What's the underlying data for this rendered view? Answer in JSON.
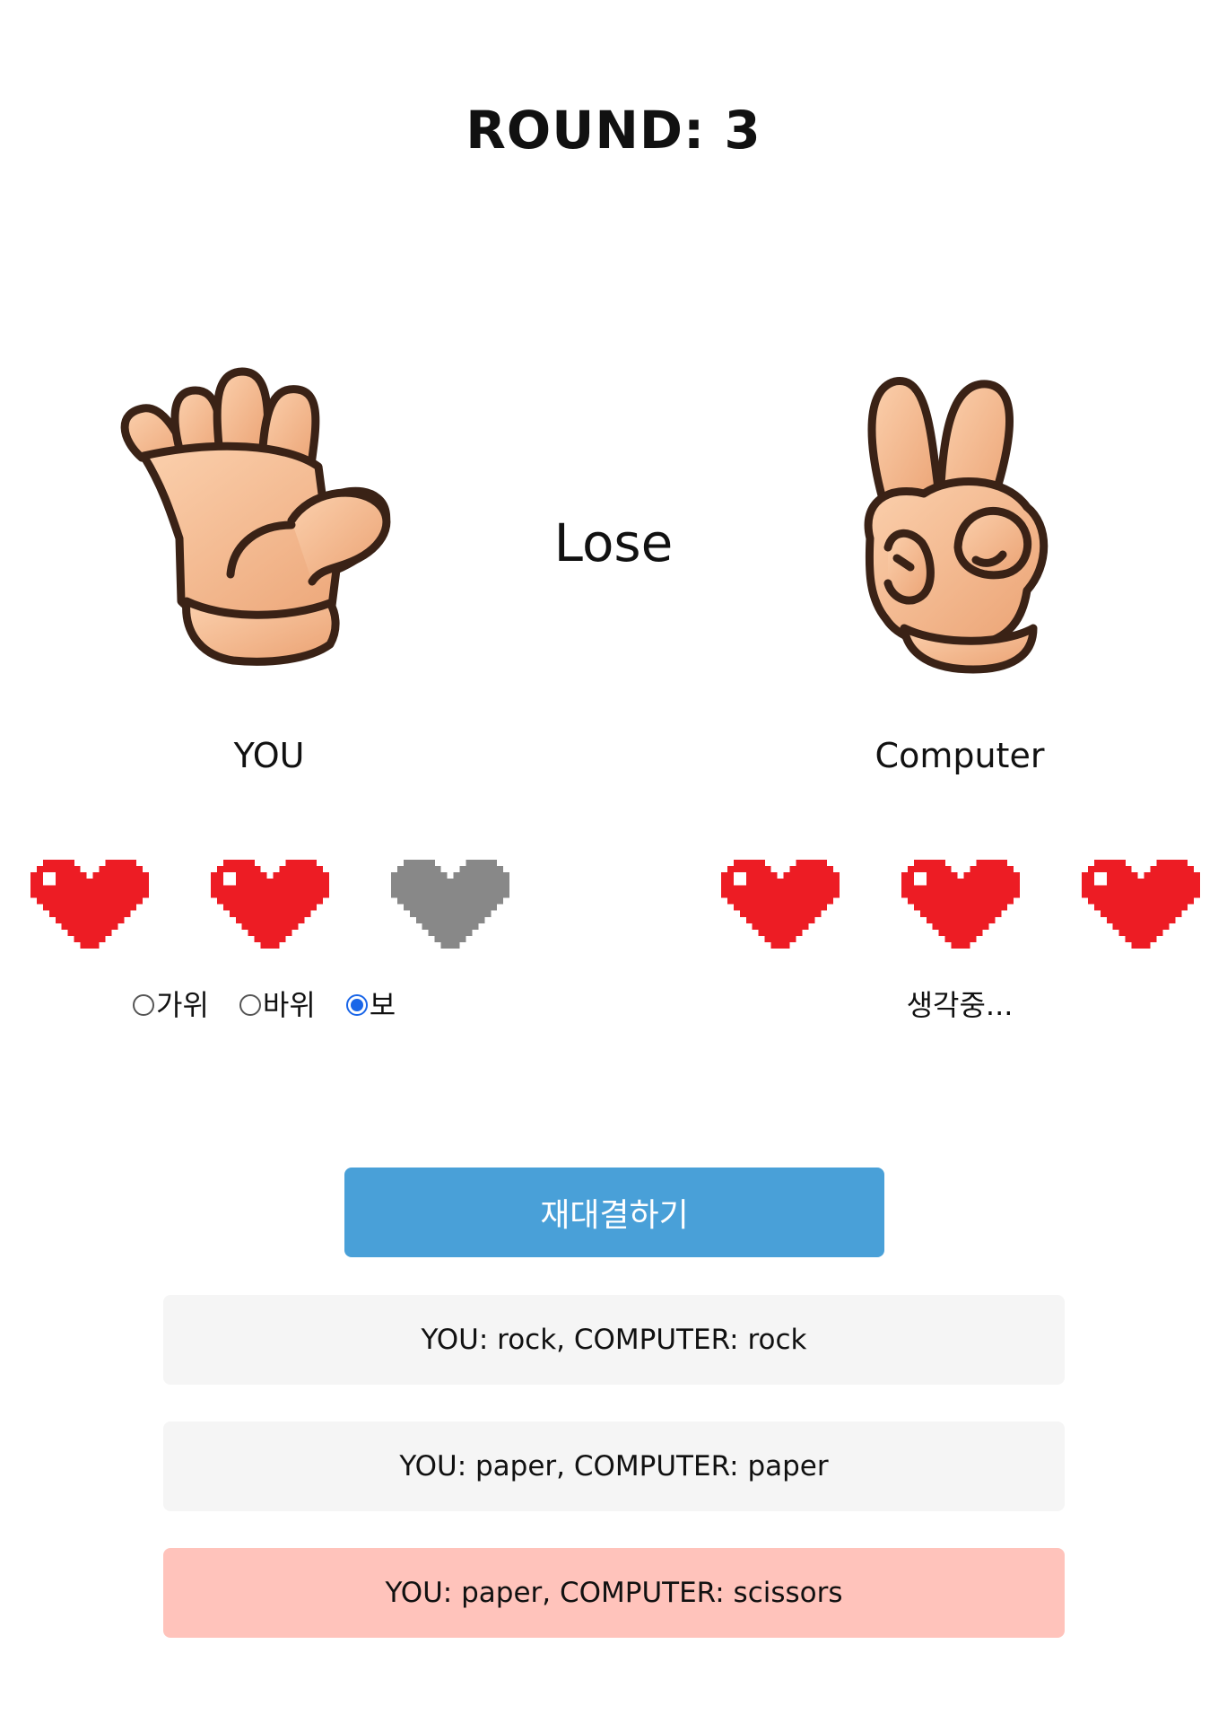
{
  "game": {
    "round_title": "ROUND: 3",
    "result": "Lose"
  },
  "players": {
    "you": {
      "label": "YOU",
      "hand": "paper-hand-icon",
      "hearts": [
        "full",
        "full",
        "empty"
      ]
    },
    "computer": {
      "label": "Computer",
      "hand": "scissors-hand-icon",
      "hearts": [
        "full",
        "full",
        "full"
      ],
      "status": "생각중..."
    }
  },
  "choices": {
    "options": [
      {
        "label": "가위",
        "checked": false
      },
      {
        "label": "바위",
        "checked": false
      },
      {
        "label": "보",
        "checked": true
      }
    ]
  },
  "buttons": {
    "rematch": "재대결하기"
  },
  "history": [
    {
      "text": "YOU: rock, COMPUTER: rock",
      "outcome": "draw"
    },
    {
      "text": "YOU: paper, COMPUTER: paper",
      "outcome": "draw"
    },
    {
      "text": "YOU: paper, COMPUTER: scissors",
      "outcome": "lose"
    }
  ],
  "colors": {
    "heart_full": "#ed1c24",
    "heart_empty": "#888888",
    "heart_highlight": "#ffffff",
    "button": "#49a0d8",
    "history_default": "#f5f5f5",
    "history_lose": "#ffc3bb",
    "radio_checked": "#1a66e8"
  }
}
